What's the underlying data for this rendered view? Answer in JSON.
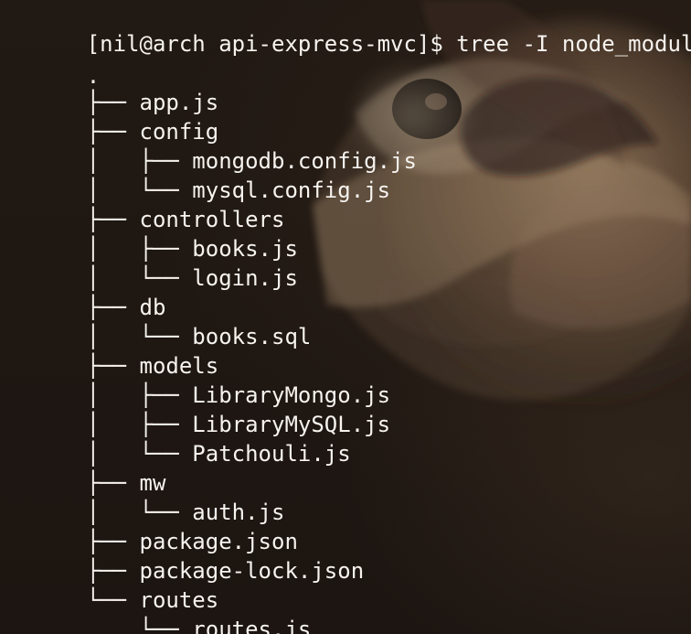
{
  "terminal": {
    "prompt": "[nil@arch api-express-mvc]$ tree -I node_modules",
    "root": "."
  },
  "tree": {
    "lines": [
      {
        "prefix": "├── ",
        "name": "app.js"
      },
      {
        "prefix": "├── ",
        "name": "config"
      },
      {
        "prefix": "│   ├── ",
        "name": "mongodb.config.js"
      },
      {
        "prefix": "│   └── ",
        "name": "mysql.config.js"
      },
      {
        "prefix": "├── ",
        "name": "controllers"
      },
      {
        "prefix": "│   ├── ",
        "name": "books.js"
      },
      {
        "prefix": "│   └── ",
        "name": "login.js"
      },
      {
        "prefix": "├── ",
        "name": "db"
      },
      {
        "prefix": "│   └── ",
        "name": "books.sql"
      },
      {
        "prefix": "├── ",
        "name": "models"
      },
      {
        "prefix": "│   ├── ",
        "name": "LibraryMongo.js"
      },
      {
        "prefix": "│   ├── ",
        "name": "LibraryMySQL.js"
      },
      {
        "prefix": "│   └── ",
        "name": "Patchouli.js"
      },
      {
        "prefix": "├── ",
        "name": "mw"
      },
      {
        "prefix": "│   └── ",
        "name": "auth.js"
      },
      {
        "prefix": "├── ",
        "name": "package.json"
      },
      {
        "prefix": "├── ",
        "name": "package-lock.json"
      },
      {
        "prefix": "└── ",
        "name": "routes"
      },
      {
        "prefix": "    └── ",
        "name": "routes.js"
      }
    ]
  }
}
